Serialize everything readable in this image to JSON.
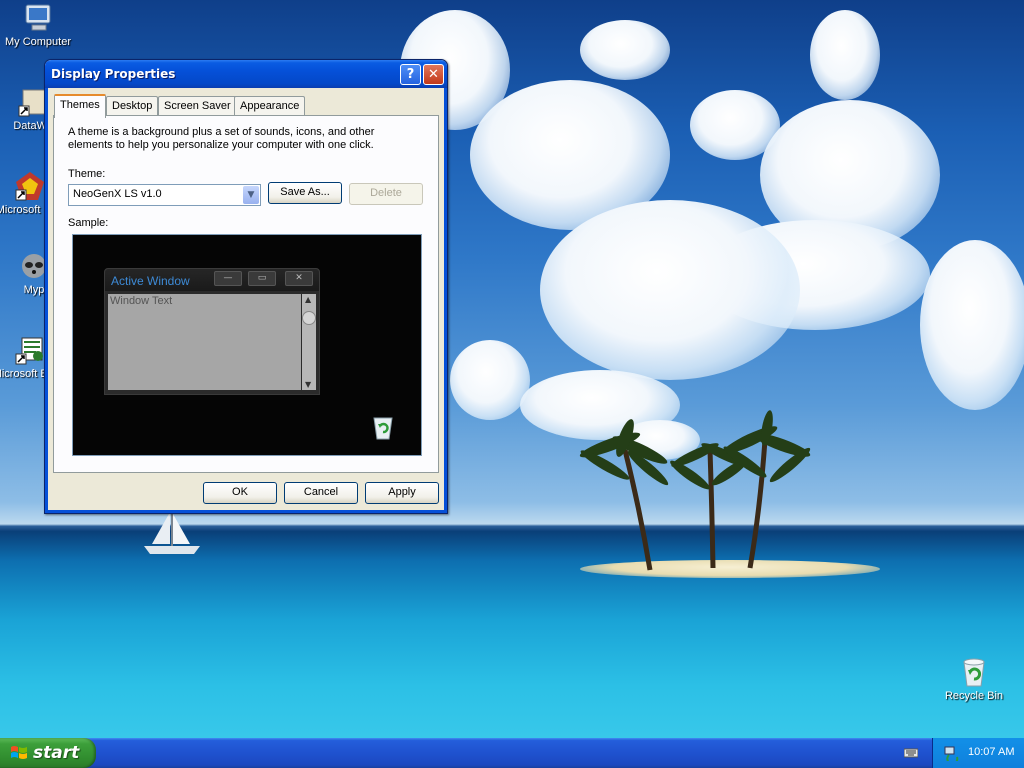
{
  "desktop": {
    "icons": [
      {
        "label": "My Computer"
      },
      {
        "label": "DataWa"
      },
      {
        "label": "Microsoft C++"
      },
      {
        "label": "Myp"
      },
      {
        "label": "Microsoft Basic"
      },
      {
        "label": "Recycle Bin"
      }
    ]
  },
  "window": {
    "title": "Display Properties",
    "help_label": "?",
    "close_label": "✕",
    "tabs": [
      {
        "label": "Themes",
        "active": true
      },
      {
        "label": "Desktop"
      },
      {
        "label": "Screen Saver"
      },
      {
        "label": "Appearance"
      }
    ],
    "description": "A theme is a background plus a set of sounds, icons, and other elements to help you personalize your computer with one click.",
    "theme_label": "Theme:",
    "theme_value": "NeoGenX LS v1.0",
    "save_as_label": "Save As...",
    "delete_label": "Delete",
    "sample_label": "Sample:",
    "sample": {
      "active_window_title": "Active Window",
      "window_text": "Window Text"
    },
    "ok_label": "OK",
    "cancel_label": "Cancel",
    "apply_label": "Apply"
  },
  "taskbar": {
    "start_label": "start",
    "clock": "10:07 AM"
  },
  "colors": {
    "titlebar": "#0550d8",
    "start_green": "#3c9f3a",
    "taskbar_blue": "#245edb",
    "sample_title": "#3d8ad6"
  }
}
